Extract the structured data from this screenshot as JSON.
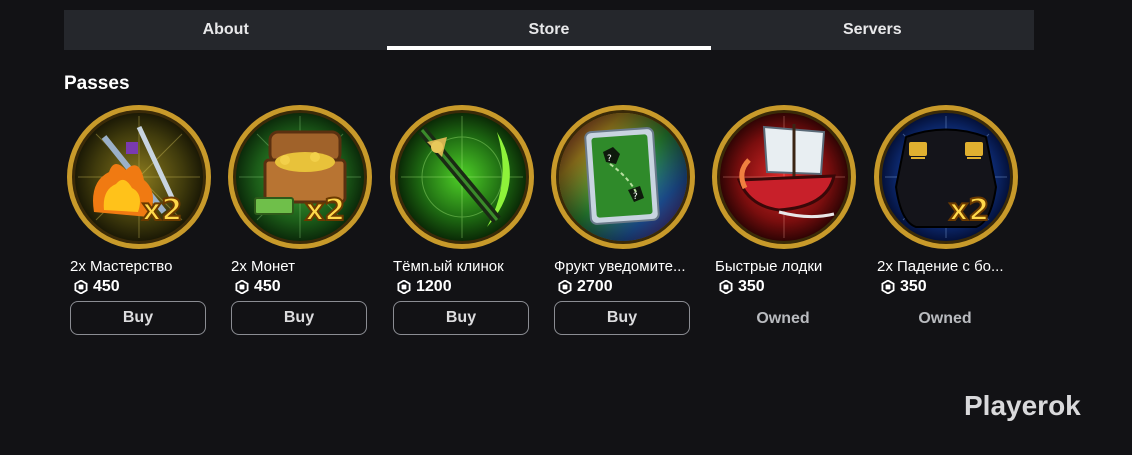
{
  "tabs": [
    {
      "label": "About"
    },
    {
      "label": "Store"
    },
    {
      "label": "Servers"
    }
  ],
  "active_tab": "Store",
  "section": {
    "title": "Passes"
  },
  "passes": [
    {
      "title": "2x Мастерство",
      "price": "450",
      "action": "Buy",
      "icon": "mastery-x2-icon"
    },
    {
      "title": "2x Монет",
      "price": "450",
      "action": "Buy",
      "icon": "money-chest-x2-icon"
    },
    {
      "title": "Тёмn.ый клинок",
      "price": "1200",
      "action": "Buy",
      "icon": "dark-blade-icon"
    },
    {
      "title": "Фрукт уведомите...",
      "price": "2700",
      "action": "Buy",
      "icon": "fruit-notifier-map-icon"
    },
    {
      "title": "Быстрые лодки",
      "price": "350",
      "status": "Owned",
      "icon": "fast-boats-icon"
    },
    {
      "title": "2x Падение с бо...",
      "price": "350",
      "status": "Owned",
      "icon": "boss-drops-x2-icon"
    }
  ],
  "colors": {
    "background": "#121215",
    "tab_bar": "#25272c",
    "gold_ring": "#c89a2a"
  },
  "watermark": "Playerok"
}
